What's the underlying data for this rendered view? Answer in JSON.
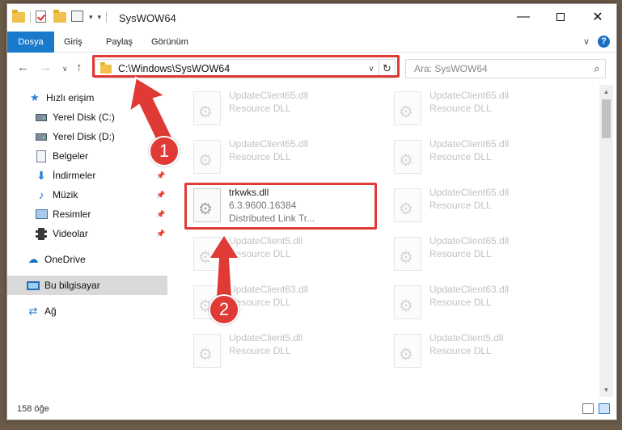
{
  "window": {
    "title": "SysWOW64",
    "min_glyph": "—",
    "close_glyph": "✕"
  },
  "quick_access": {
    "dropdown_glyph": "▾",
    "dropdown2_glyph": "▾"
  },
  "ribbon": {
    "tabs": [
      "Dosya",
      "Giriş",
      "Paylaş",
      "Görünüm"
    ],
    "expand_glyph": "∨",
    "help_glyph": "?"
  },
  "navigation": {
    "back_glyph": "←",
    "forward_glyph": "→",
    "history_glyph": "∨",
    "up_glyph": "↑"
  },
  "address": {
    "path": "C:\\Windows\\SysWOW64",
    "dropdown_glyph": "∨",
    "refresh_glyph": "↻"
  },
  "search": {
    "placeholder": "Ara: SysWOW64",
    "icon_glyph": "⌕"
  },
  "sidebar": {
    "items": [
      {
        "label": "Hızlı erişim",
        "icon": "star-icon",
        "glyph": "★"
      },
      {
        "label": "Yerel Disk (C:)",
        "icon": "drive-icon"
      },
      {
        "label": "Yerel Disk (D:)",
        "icon": "drive-icon"
      },
      {
        "label": "Belgeler",
        "icon": "document-icon"
      },
      {
        "label": "İndirmeler",
        "icon": "download-icon",
        "glyph": "⬇"
      },
      {
        "label": "Müzik",
        "icon": "music-icon",
        "glyph": "♪"
      },
      {
        "label": "Resimler",
        "icon": "picture-icon"
      },
      {
        "label": "Videolar",
        "icon": "video-icon"
      },
      {
        "label": "OneDrive",
        "icon": "cloud-icon",
        "glyph": "☁"
      },
      {
        "label": "Bu bilgisayar",
        "icon": "computer-icon"
      },
      {
        "label": "Ağ",
        "icon": "network-icon",
        "glyph": "⇄"
      }
    ],
    "pin_glyph": "📌",
    "selected": "Bu bilgisayar"
  },
  "files": [
    {
      "name": "UpdateClient65.dll",
      "line1": "Resource DLL",
      "line2": ""
    },
    {
      "name": "UpdateClient65.dll",
      "line1": "Resource DLL",
      "line2": ""
    },
    {
      "name": "UpdateClient65.dll",
      "line1": "Resource DLL",
      "line2": ""
    },
    {
      "name": "UpdateClient65.dll",
      "line1": "Resource DLL",
      "line2": ""
    },
    {
      "name": "trkwks.dll",
      "line1": "6.3.9600.16384",
      "line2": "Distributed Link Tr..."
    },
    {
      "name": "UpdateClient65.dll",
      "line1": "Resource DLL",
      "line2": ""
    },
    {
      "name": "UpdateClient5.dll",
      "line1": "Resource DLL",
      "line2": ""
    },
    {
      "name": "UpdateClient65.dll",
      "line1": "Resource DLL",
      "line2": ""
    },
    {
      "name": "UpdateClient63.dll",
      "line1": "Resource DLL",
      "line2": ""
    },
    {
      "name": "UpdateClient63.dll",
      "line1": "Resource DLL",
      "line2": ""
    },
    {
      "name": "UpdateClient5.dll",
      "line1": "Resource DLL",
      "line2": ""
    },
    {
      "name": "UpdateClient5.dll",
      "line1": "Resource DLL",
      "line2": ""
    }
  ],
  "scrollbar": {
    "up_glyph": "▲",
    "down_glyph": "▼"
  },
  "status": {
    "count_text": "158 öğe"
  },
  "annotations": {
    "badge1": "1",
    "badge2": "2",
    "color": "#e03a36"
  }
}
